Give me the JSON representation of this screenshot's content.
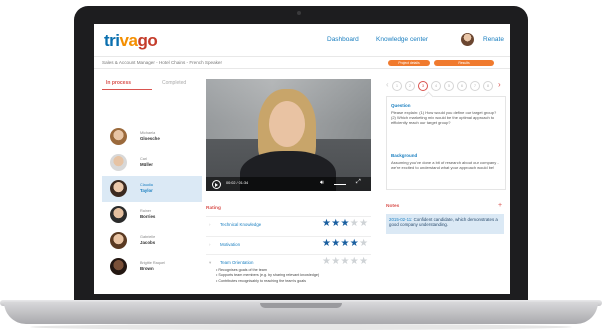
{
  "brand": {
    "logo_letters": [
      {
        "ch": "t",
        "color": "#0a6faf"
      },
      {
        "ch": "r",
        "color": "#0a6faf"
      },
      {
        "ch": "i",
        "color": "#0a6faf"
      },
      {
        "ch": "v",
        "color": "#f48f00"
      },
      {
        "ch": "a",
        "color": "#f48f00"
      },
      {
        "ch": "g",
        "color": "#c43c2b"
      },
      {
        "ch": "o",
        "color": "#c43c2b"
      }
    ]
  },
  "nav": {
    "dashboard": "Dashboard",
    "knowledge_center": "Knowledge center",
    "user": "Renate"
  },
  "breadcrumb": "Sales & Account Manager - Hotel Chains - French Speaker",
  "stage_pills": {
    "project_details": "Project details",
    "results": "Results"
  },
  "tabs": {
    "in_process": "In process",
    "completed": "Completed"
  },
  "candidates": [
    {
      "first": "Michaela",
      "last": "Gloesche",
      "selected": false,
      "skin": "#e8c5a5",
      "hair": "#9b6a3c"
    },
    {
      "first": "Carl",
      "last": "Müller",
      "selected": false,
      "skin": "#e6c3a4",
      "hair": "#d8d8d8"
    },
    {
      "first": "Claudia",
      "last": "Taylor",
      "selected": true,
      "skin": "#ecc9ab",
      "hair": "#3b2a20"
    },
    {
      "first": "Rainer",
      "last": "Borries",
      "selected": false,
      "skin": "#e4bf9f",
      "hair": "#2b2b2b"
    },
    {
      "first": "Gabrielle",
      "last": "Jacobs",
      "selected": false,
      "skin": "#e9c4a4",
      "hair": "#5a3a22"
    },
    {
      "first": "Brigitte Raquel",
      "last": "Brown",
      "selected": false,
      "skin": "#7a5038",
      "hair": "#231712"
    }
  ],
  "video": {
    "time": "00:02 / 01:34",
    "icons": [
      "play-icon",
      "volume-icon",
      "fullscreen-icon"
    ]
  },
  "rating": {
    "heading": "Rating",
    "criteria": [
      {
        "label": "Technical Knowledge",
        "stars": 3,
        "max": 5
      },
      {
        "label": "Motivation",
        "stars": 4,
        "max": 5
      },
      {
        "label": "Team Orientation",
        "stars": 0,
        "max": 5
      }
    ],
    "team_points": [
      "Recognises goals of the team",
      "Supports team members (e.g. by sharing relevant knowledge)",
      "Contributes recognisably to reaching the team's goals"
    ]
  },
  "questions": {
    "steps": [
      "1",
      "2",
      "3",
      "4",
      "5",
      "6",
      "7",
      "8"
    ],
    "current_step": 3,
    "question_heading": "Question",
    "question_text": "Please explain: (1) How would you define our target group? (2) Which marketing mix would be the optimal approach to efficiently reach our target group?",
    "background_heading": "Background",
    "background_text": "Assuming you've done a bit of research about our company - we're excited to understand what your approach would be!"
  },
  "notes": {
    "heading": "Notes",
    "add_symbol": "+",
    "date": "2015-02-11:",
    "text": "Confident candidate, which demonstrates a good company understanding."
  },
  "colors": {
    "accent_blue": "#1a7fc0",
    "accent_red": "#d9534f",
    "pill_orange": "#f07a2e",
    "selected_bg": "#dbe9f5"
  }
}
